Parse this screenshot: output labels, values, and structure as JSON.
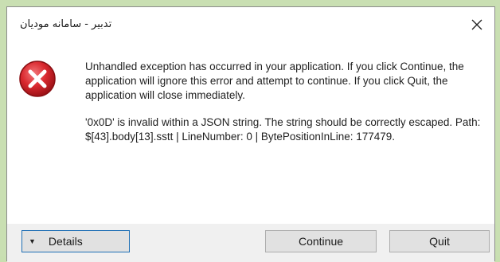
{
  "dialog": {
    "title": "تدبیر - سامانه مودیان",
    "close_glyph": "✕",
    "icon": "error-icon",
    "message": {
      "paragraph1": "Unhandled exception has occurred in your application. If you click Continue, the application will ignore this error and attempt to continue. If you click Quit, the application will close immediately.",
      "paragraph2": "'0x0D' is invalid within a JSON string. The string should be correctly escaped. Path: $[43].body[13].sstt | LineNumber: 0 | BytePositionInLine: 177479."
    },
    "buttons": {
      "details_caret": "▼",
      "details_label": "Details",
      "continue_label": "Continue",
      "quit_label": "Quit"
    }
  },
  "colors": {
    "backdrop": "#c9dfb2",
    "dialog_bg": "#f0f0f0",
    "content_bg": "#ffffff",
    "error_red": "#d9282e",
    "focus_border": "#1f6fb5"
  }
}
